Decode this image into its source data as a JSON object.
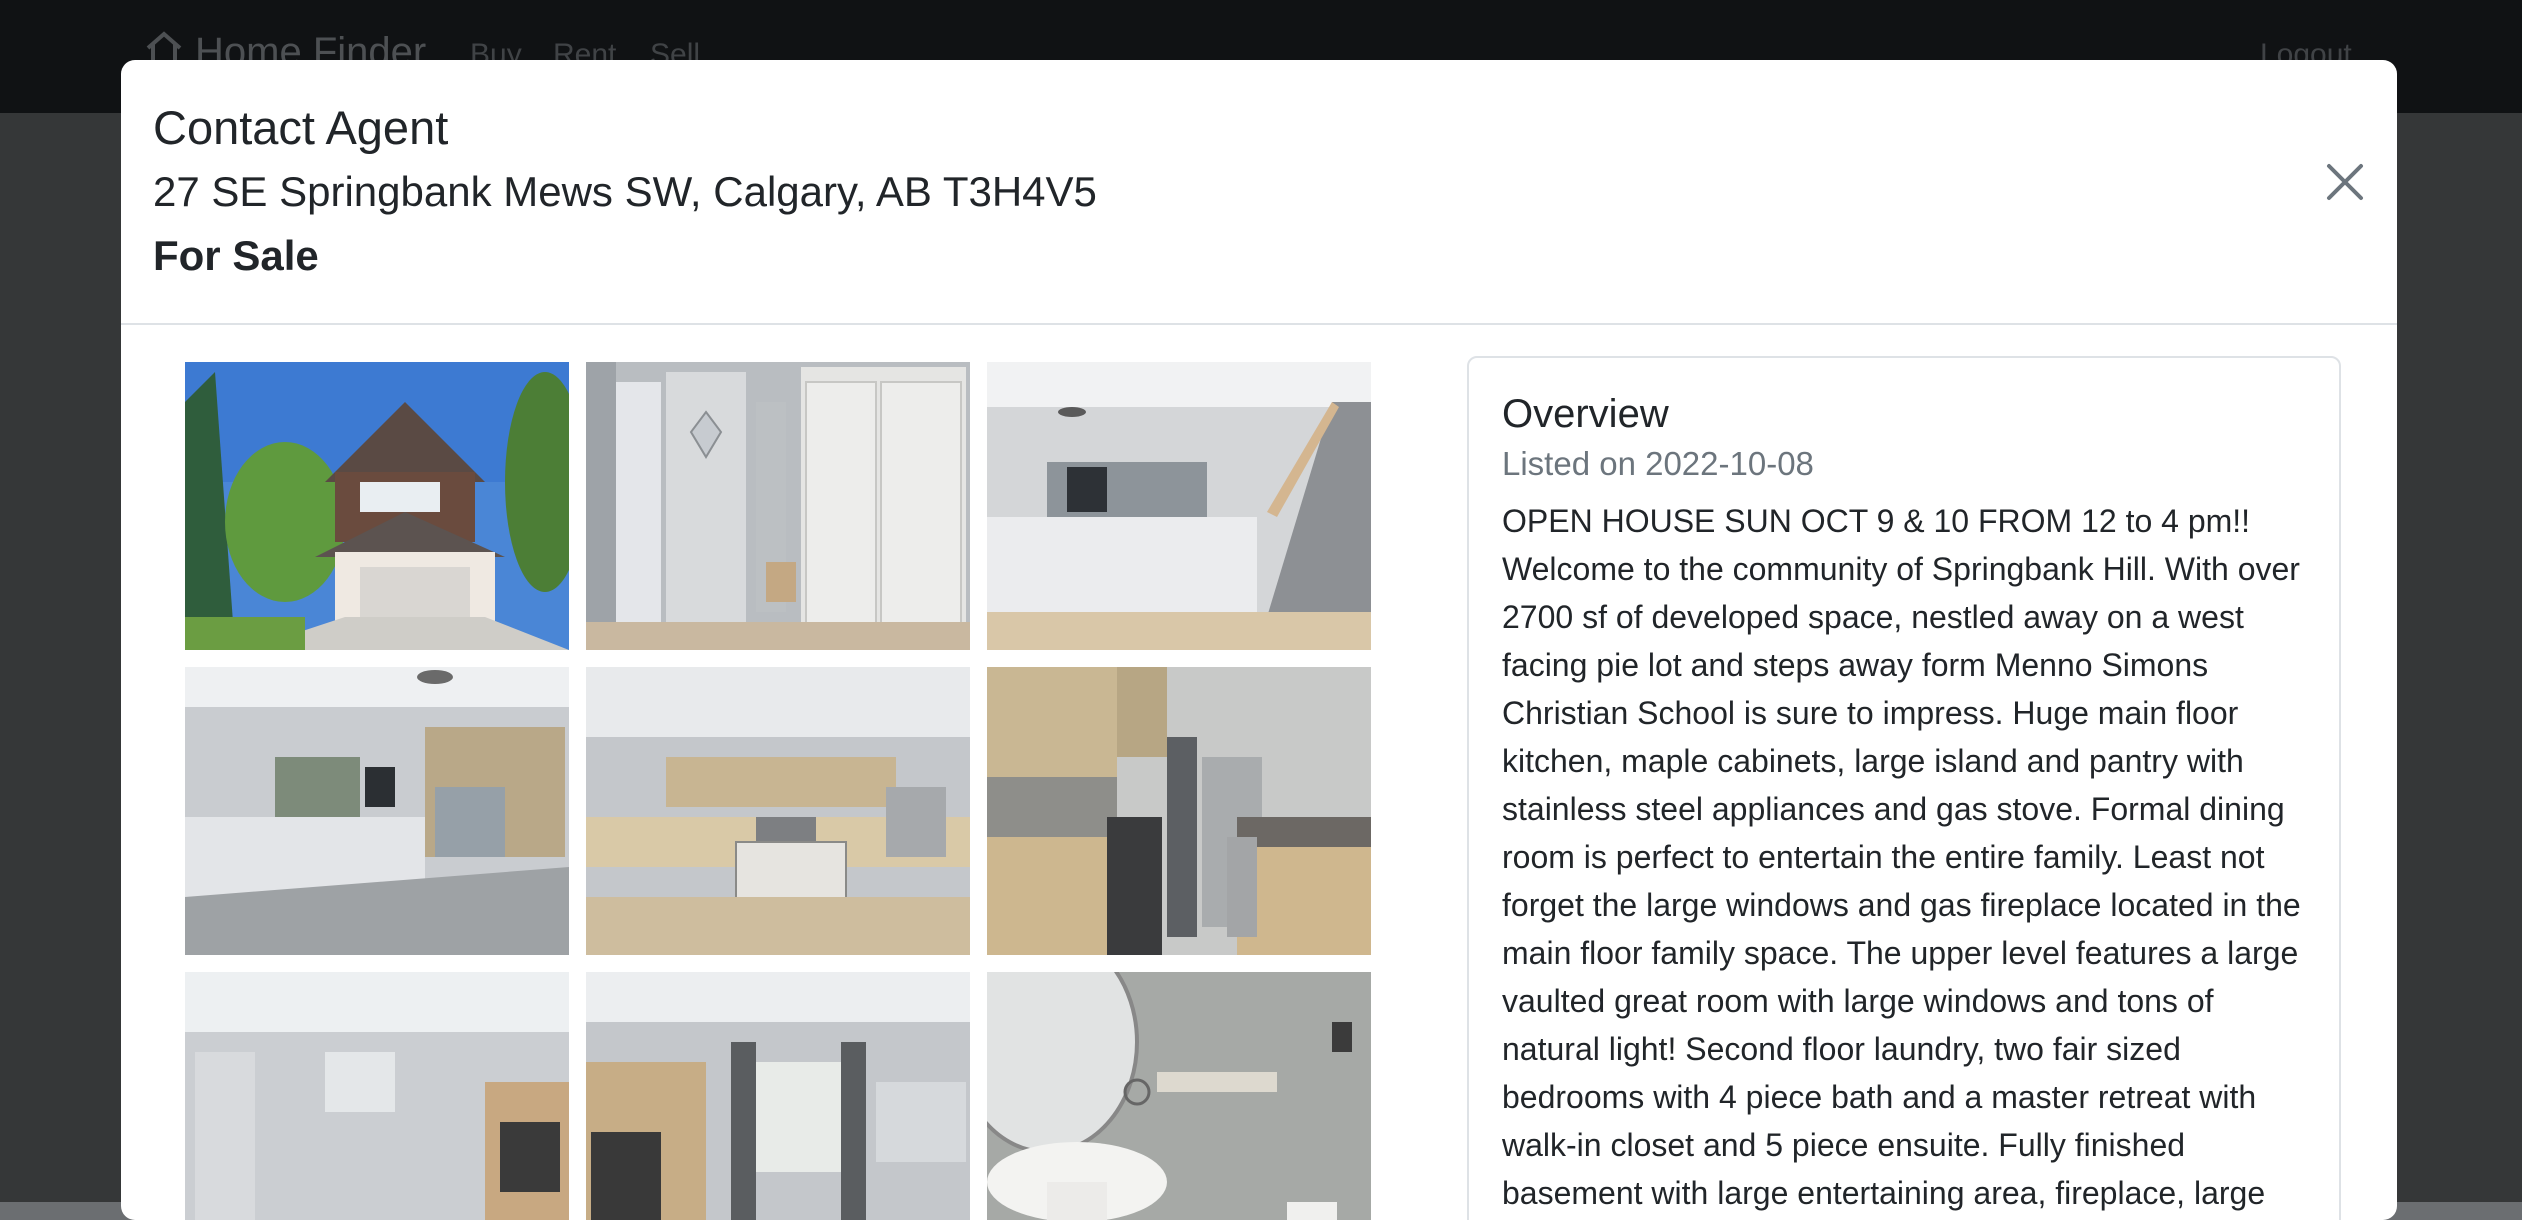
{
  "navbar": {
    "brand": "Home Finder",
    "links": [
      "Buy",
      "Rent",
      "Sell"
    ],
    "logout": "Logout"
  },
  "modal": {
    "title": "Contact Agent",
    "address": "27 SE Springbank Mews SW, Calgary, AB T3H4V5",
    "status": "For Sale",
    "close_icon": "close-icon"
  },
  "photos": [
    "house-exterior",
    "entry-door-closet",
    "stairway-hall",
    "living-room",
    "kitchen-island",
    "kitchen-appliances",
    "family-room-fireplace",
    "fireplace-windows",
    "bathroom-sink"
  ],
  "overview": {
    "title": "Overview",
    "listed": "Listed on 2022-10-08",
    "description": "OPEN HOUSE SUN OCT 9 & 10 FROM 12 to 4 pm!! Welcome to the community of Springbank Hill. With over 2700 sf of developed space, nestled away on a west facing pie lot and steps away form Menno Simons Christian School is sure to impress. Huge main floor kitchen, maple cabinets, large island and pantry with stainless steel appliances and gas stove. Formal dining room is perfect to entertain the entire family. Least not forget the large windows and gas fireplace located in the main floor family space. The upper level features a large vaulted great room with large windows and tons of natural light! Second floor laundry, two fair sized bedrooms with 4 piece bath and a master retreat with walk-in closet and 5 piece ensuite. Fully finished basement with large entertaining area, fireplace, large"
  }
}
